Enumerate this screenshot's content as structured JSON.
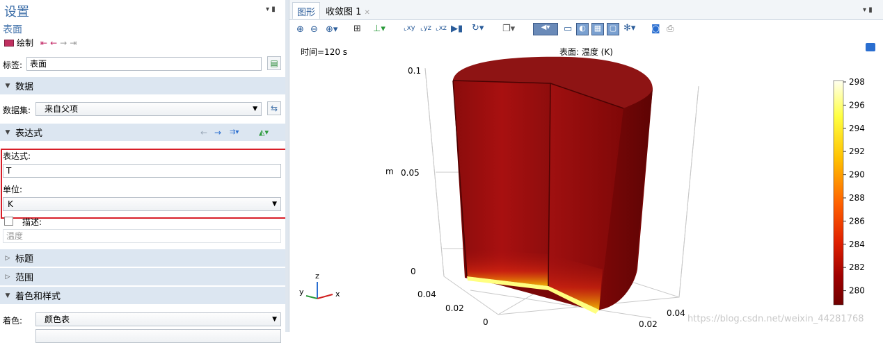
{
  "left": {
    "title": "设置",
    "subtitle": "表面",
    "plot_label": "绘制",
    "label_field": {
      "label": "标签:",
      "value": "表面"
    },
    "sections": {
      "data": "数据",
      "expression": "表达式",
      "title": "标题",
      "range": "范围",
      "coloring": "着色和样式"
    },
    "dataset": {
      "label": "数据集:",
      "value": "来自父项"
    },
    "expression": {
      "label": "表达式:",
      "value": "T"
    },
    "unit": {
      "label": "单位:",
      "value": "K"
    },
    "description": {
      "label": "描述:",
      "value": "温度"
    },
    "color": {
      "label": "着色:",
      "value": "颜色表"
    }
  },
  "right": {
    "tabs": [
      {
        "label": "图形"
      },
      {
        "label": "收敛图 1"
      }
    ],
    "time_label": "时间=120 s",
    "surface_label": "表面: 温度 (K)",
    "axis": {
      "z_ticks": [
        "0.1",
        "0.05",
        "0"
      ],
      "z_unit": "m",
      "x_ticks": [
        "0.04",
        "0.02",
        "0"
      ],
      "y_ticks": [
        "0.02",
        "0.04"
      ],
      "triad": {
        "x": "x",
        "y": "y",
        "z": "z"
      }
    },
    "colorbar": {
      "ticks": [
        "298",
        "296",
        "294",
        "292",
        "290",
        "288",
        "286",
        "284",
        "282",
        "280"
      ],
      "colors": [
        "#fffff0",
        "#ffff40",
        "#ffc000",
        "#ff6000",
        "#e02000",
        "#a00000",
        "#700000"
      ]
    },
    "watermark": "https://blog.csdn.net/weixin_44281768"
  }
}
